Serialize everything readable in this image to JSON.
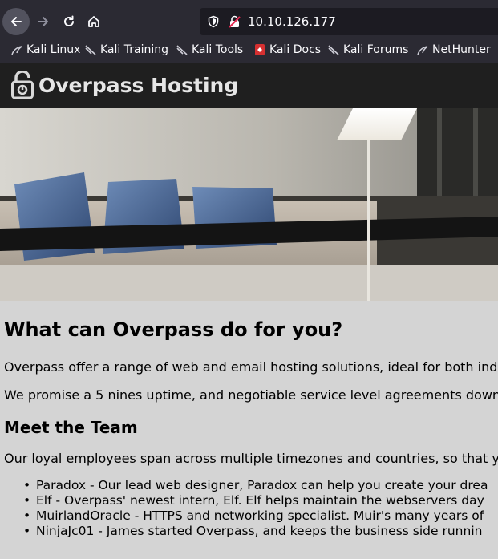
{
  "browser": {
    "url": "10.10.126.177",
    "bookmarks": [
      "Kali Linux",
      "Kali Training",
      "Kali Tools",
      "Kali Docs",
      "Kali Forums",
      "NetHunter"
    ]
  },
  "site": {
    "brand": "Overpass Hosting"
  },
  "main": {
    "heading": "What can Overpass do for you?",
    "intro": "Overpass offer a range of web and email hosting solutions, ideal for both ind",
    "promise": "We promise a 5 nines uptime, and negotiable service level agreements down",
    "team_heading": "Meet the Team",
    "team_intro": "Our loyal employees span across multiple timezones and countries, so that y",
    "team": [
      "Paradox - Our lead web designer, Paradox can help you create your drea",
      "Elf - Overpass' newest intern, Elf. Elf helps maintain the webservers day",
      "MuirlandOracle - HTTPS and networking specialist. Muir's many years of",
      "NinjaJc01 - James started Overpass, and keeps the business side runnin"
    ]
  }
}
